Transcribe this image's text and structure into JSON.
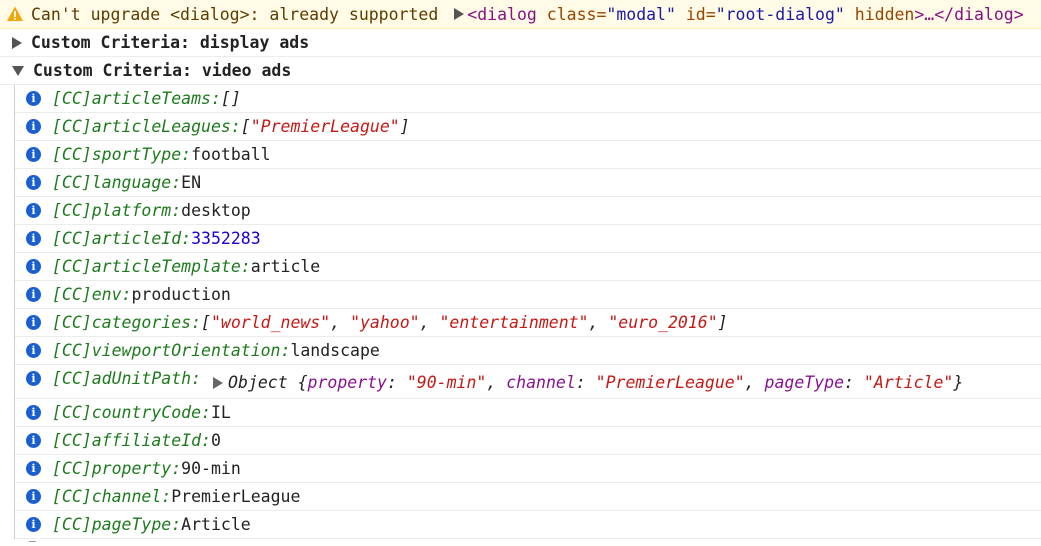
{
  "warning": {
    "message": "Can't upgrade <dialog>: already supported",
    "tag_open": "<dialog",
    "attr1_name": "class=",
    "attr1_value": "\"modal\"",
    "attr2_name": "id=",
    "attr2_value": "\"root-dialog\"",
    "attr3_name": "hidden",
    "tag_close": ">…</dialog>"
  },
  "groups": [
    {
      "title": "Custom Criteria: display ads",
      "expanded": false
    },
    {
      "title": "Custom Criteria: video ads",
      "expanded": true
    }
  ],
  "prefix": "[CC]",
  "logs": [
    {
      "key": "articleTeams:",
      "value": "[]",
      "type": "plain-italic"
    },
    {
      "key": "articleLeagues:",
      "value": "[\"PremierLeague\"]",
      "type": "str-array"
    },
    {
      "key": "sportType:",
      "value": "football",
      "type": "plain"
    },
    {
      "key": "language:",
      "value": "EN",
      "type": "plain"
    },
    {
      "key": "platform:",
      "value": "desktop",
      "type": "plain"
    },
    {
      "key": "articleId:",
      "value": "3352283",
      "type": "num"
    },
    {
      "key": "articleTemplate:",
      "value": "article",
      "type": "plain"
    },
    {
      "key": "env:",
      "value": "production",
      "type": "plain"
    },
    {
      "key": "categories:",
      "value": "[\"world_news\", \"yahoo\", \"entertainment\", \"euro_2016\"]",
      "type": "str-array"
    },
    {
      "key": "viewportOrientation:",
      "value": "landscape",
      "type": "plain"
    },
    {
      "key": "adUnitPath:",
      "type": "object",
      "object": {
        "label": "Object",
        "props": [
          {
            "k": "property",
            "v": "\"90-min\""
          },
          {
            "k": "channel",
            "v": "\"PremierLeague\""
          },
          {
            "k": "pageType",
            "v": "\"Article\""
          }
        ]
      }
    },
    {
      "key": "countryCode:",
      "value": "IL",
      "type": "plain"
    },
    {
      "key": "affiliateId:",
      "value": "0",
      "type": "plain"
    },
    {
      "key": "property:",
      "value": "90-min",
      "type": "plain"
    },
    {
      "key": "channel:",
      "value": "PremierLeague",
      "type": "plain"
    },
    {
      "key": "pageType:",
      "value": "Article",
      "type": "plain"
    }
  ],
  "colors": {
    "info": "#1a5fd1",
    "string": "#c41a16",
    "number": "#1c00cf",
    "prefix": "#1e7a1e",
    "warning_bg": "#fffbe6"
  }
}
